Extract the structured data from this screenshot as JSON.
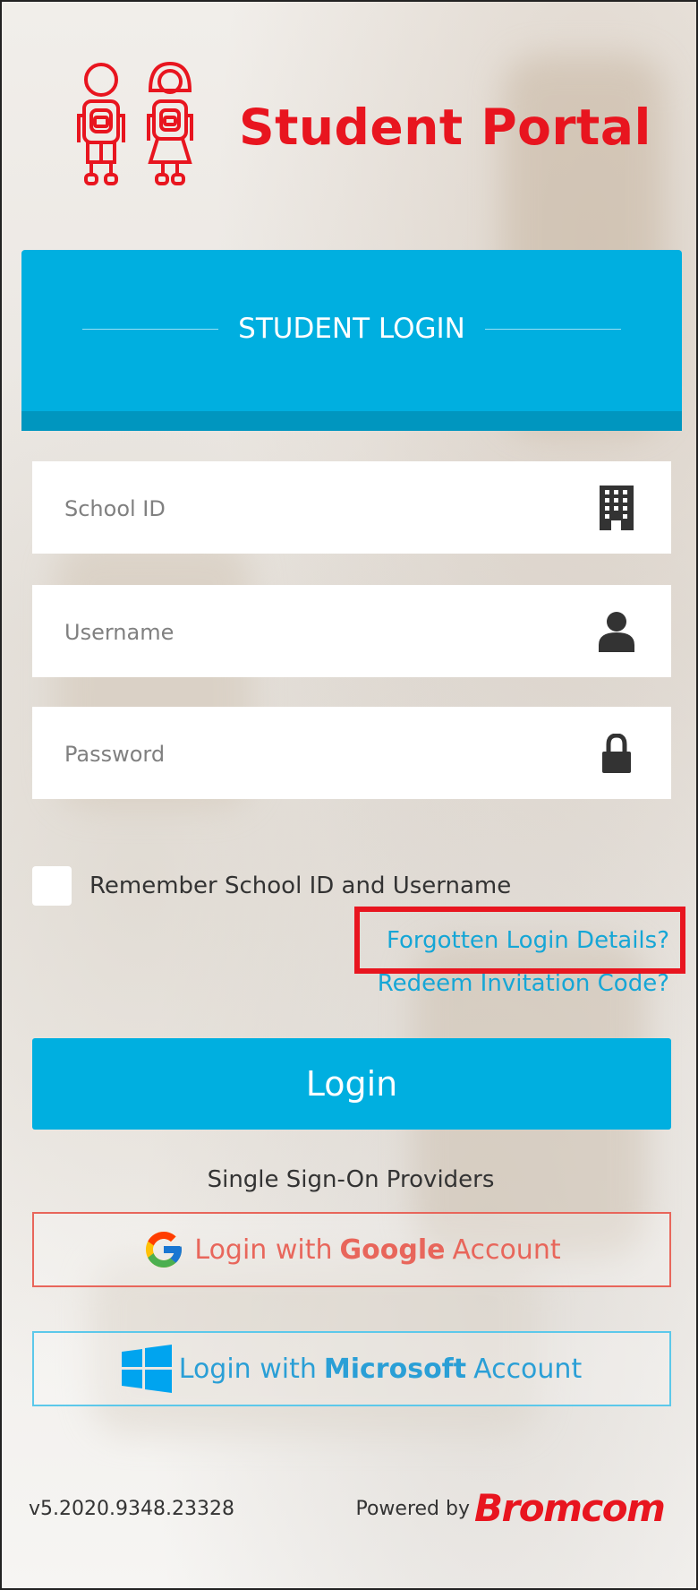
{
  "brand": {
    "title": "Student Portal"
  },
  "header": {
    "title": "STUDENT LOGIN"
  },
  "form": {
    "school_id": {
      "placeholder": "School ID",
      "value": ""
    },
    "username": {
      "placeholder": "Username",
      "value": ""
    },
    "password": {
      "placeholder": "Password",
      "value": ""
    },
    "remember_label": "Remember School ID and Username",
    "remember_checked": false
  },
  "links": {
    "forgotten": "Forgotten Login Details?",
    "redeem": "Redeem Invitation Code?"
  },
  "login_button": "Login",
  "sso": {
    "label": "Single Sign-On Providers",
    "google": {
      "prefix": "Login with",
      "provider": "Google",
      "suffix": "Account"
    },
    "microsoft": {
      "prefix": "Login with",
      "provider": "Microsoft",
      "suffix": "Account"
    }
  },
  "footer": {
    "version": "v5.2020.9348.23328",
    "powered_by": "Powered by",
    "vendor": "Bromcom"
  },
  "colors": {
    "accent": "#00afe0",
    "brand_red": "#e8151f",
    "google_red": "#e8665b",
    "microsoft_blue": "#2a9fd6",
    "link": "#15a6d6",
    "highlight": "#e8151f"
  },
  "icons": {
    "school_id": "building-icon",
    "username": "user-icon",
    "password": "lock-icon",
    "google": "google-g-icon",
    "microsoft": "windows-icon"
  }
}
